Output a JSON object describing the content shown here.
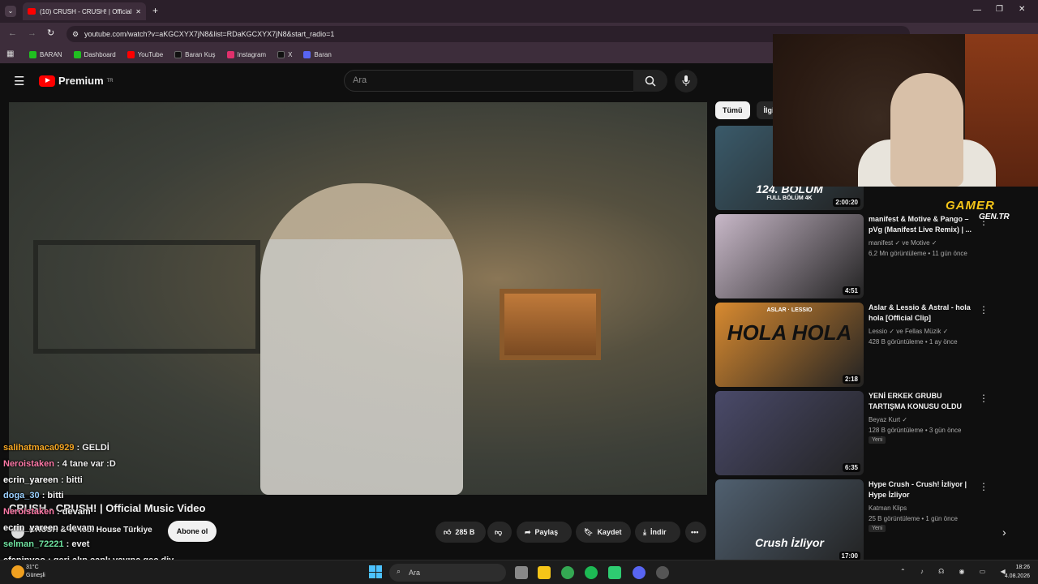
{
  "browser": {
    "tab_title": "(10) CRUSH - CRUSH! | Official",
    "url": "youtube.com/watch?v=aKGCXYX7jN8&list=RDaKGCXYX7jN8&start_radio=1",
    "bookmarks": [
      {
        "label": "BARAN",
        "color": "#20c020"
      },
      {
        "label": "Dashboard",
        "color": "#20c020"
      },
      {
        "label": "YouTube",
        "color": "#ff0000"
      },
      {
        "label": "Baran Kuş",
        "color": "#111111"
      },
      {
        "label": "Instagram",
        "color": "#e1306c"
      },
      {
        "label": "X",
        "color": "#111111"
      },
      {
        "label": "Baran",
        "color": "#5865f2"
      }
    ]
  },
  "youtube": {
    "logo_text": "Premium",
    "logo_region": "TR",
    "search_placeholder": "Ara",
    "video_title": "CRUSH - CRUSH! | Official Music Video",
    "channel_name": "CRUSH & ve lobi House Türkiye",
    "subscribe_label": "Abone ol",
    "like_count": "285 B",
    "share_label": "Paylaş",
    "save_label": "Kaydet",
    "download_label": "İndir"
  },
  "chat": [
    {
      "user": "salihatmaca0929",
      "msg": "GELDİ",
      "color": "#f5a623"
    },
    {
      "user": "Neroistaken",
      "msg": "4 tane var :D",
      "color": "#ff7aa8"
    },
    {
      "user": "ecrin_yareen",
      "msg": "bitti",
      "color": "#ffffff"
    },
    {
      "user": "doga_30",
      "msg": "bitti",
      "color": "#9ad0ff"
    },
    {
      "user": "Neroistaken",
      "msg": "devam",
      "color": "#ff7aa8"
    },
    {
      "user": "ecrin_yareen",
      "msg": "devam",
      "color": "#ffffff"
    },
    {
      "user": "selman_72221",
      "msg": "evet",
      "color": "#6fe3a0"
    },
    {
      "user": "efeninyoo",
      "msg": "geri alın canlı yayına geç diy",
      "color": "#ffffff"
    }
  ],
  "sidebar": {
    "chips": [
      "Tümü",
      "İlgili"
    ],
    "recommendations": [
      {
        "title": "",
        "channel": "",
        "views": "",
        "new": false,
        "duration": "2:00:20",
        "overlay": "124. BÖLÜM",
        "overlay2": "FULL BÖLÜM 4K",
        "thumb_color": "#3a5a6a"
      },
      {
        "title": "manifest & Motive & Pango – pVg (Manifest Live Remix) | ...",
        "channel": "manifest ✓ ve Motive ✓",
        "views": "6,2 Mn görüntüleme • 11 gün önce",
        "new": false,
        "duration": "4:51",
        "overlay": "",
        "overlay2": "",
        "thumb_color": "#c8b8c8"
      },
      {
        "title": "Aslar & Lessio & Astral - hola hola [Official Clip]",
        "channel": "Lessio ✓ ve Fellas Müzik ✓",
        "views": "428 B görüntüleme • 1 ay önce",
        "new": false,
        "duration": "2:18",
        "overlay": "HOLA HOLA",
        "overlay2": "ASLAR · LESSIO",
        "thumb_color": "#d88a30"
      },
      {
        "title": "YENİ ERKEK GRUBU TARTIŞMA KONUSU OLDU",
        "channel": "Beyaz Kurt ✓",
        "views": "128 B görüntüleme • 3 gün önce",
        "new": true,
        "duration": "6:35",
        "overlay": "",
        "overlay2": "",
        "thumb_color": "#4a4a6a"
      },
      {
        "title": "Hype Crush - Crush! İzliyor | Hype İzliyor",
        "channel": "Katman Klips",
        "views": "25 B görüntüleme • 1 gün önce",
        "new": true,
        "duration": "17:00",
        "overlay": "Crush İzliyor",
        "overlay2": "",
        "thumb_color": "#506070"
      }
    ],
    "new_badge": "Yeni"
  },
  "overlay": {
    "gamer": "GAMER",
    "gamer_sub": "GEN.TR"
  },
  "taskbar": {
    "search_placeholder": "Ara",
    "weather_temp": "31°C",
    "weather_desc": "Güneşli",
    "time": "18:26",
    "date": "4.08.2026"
  }
}
